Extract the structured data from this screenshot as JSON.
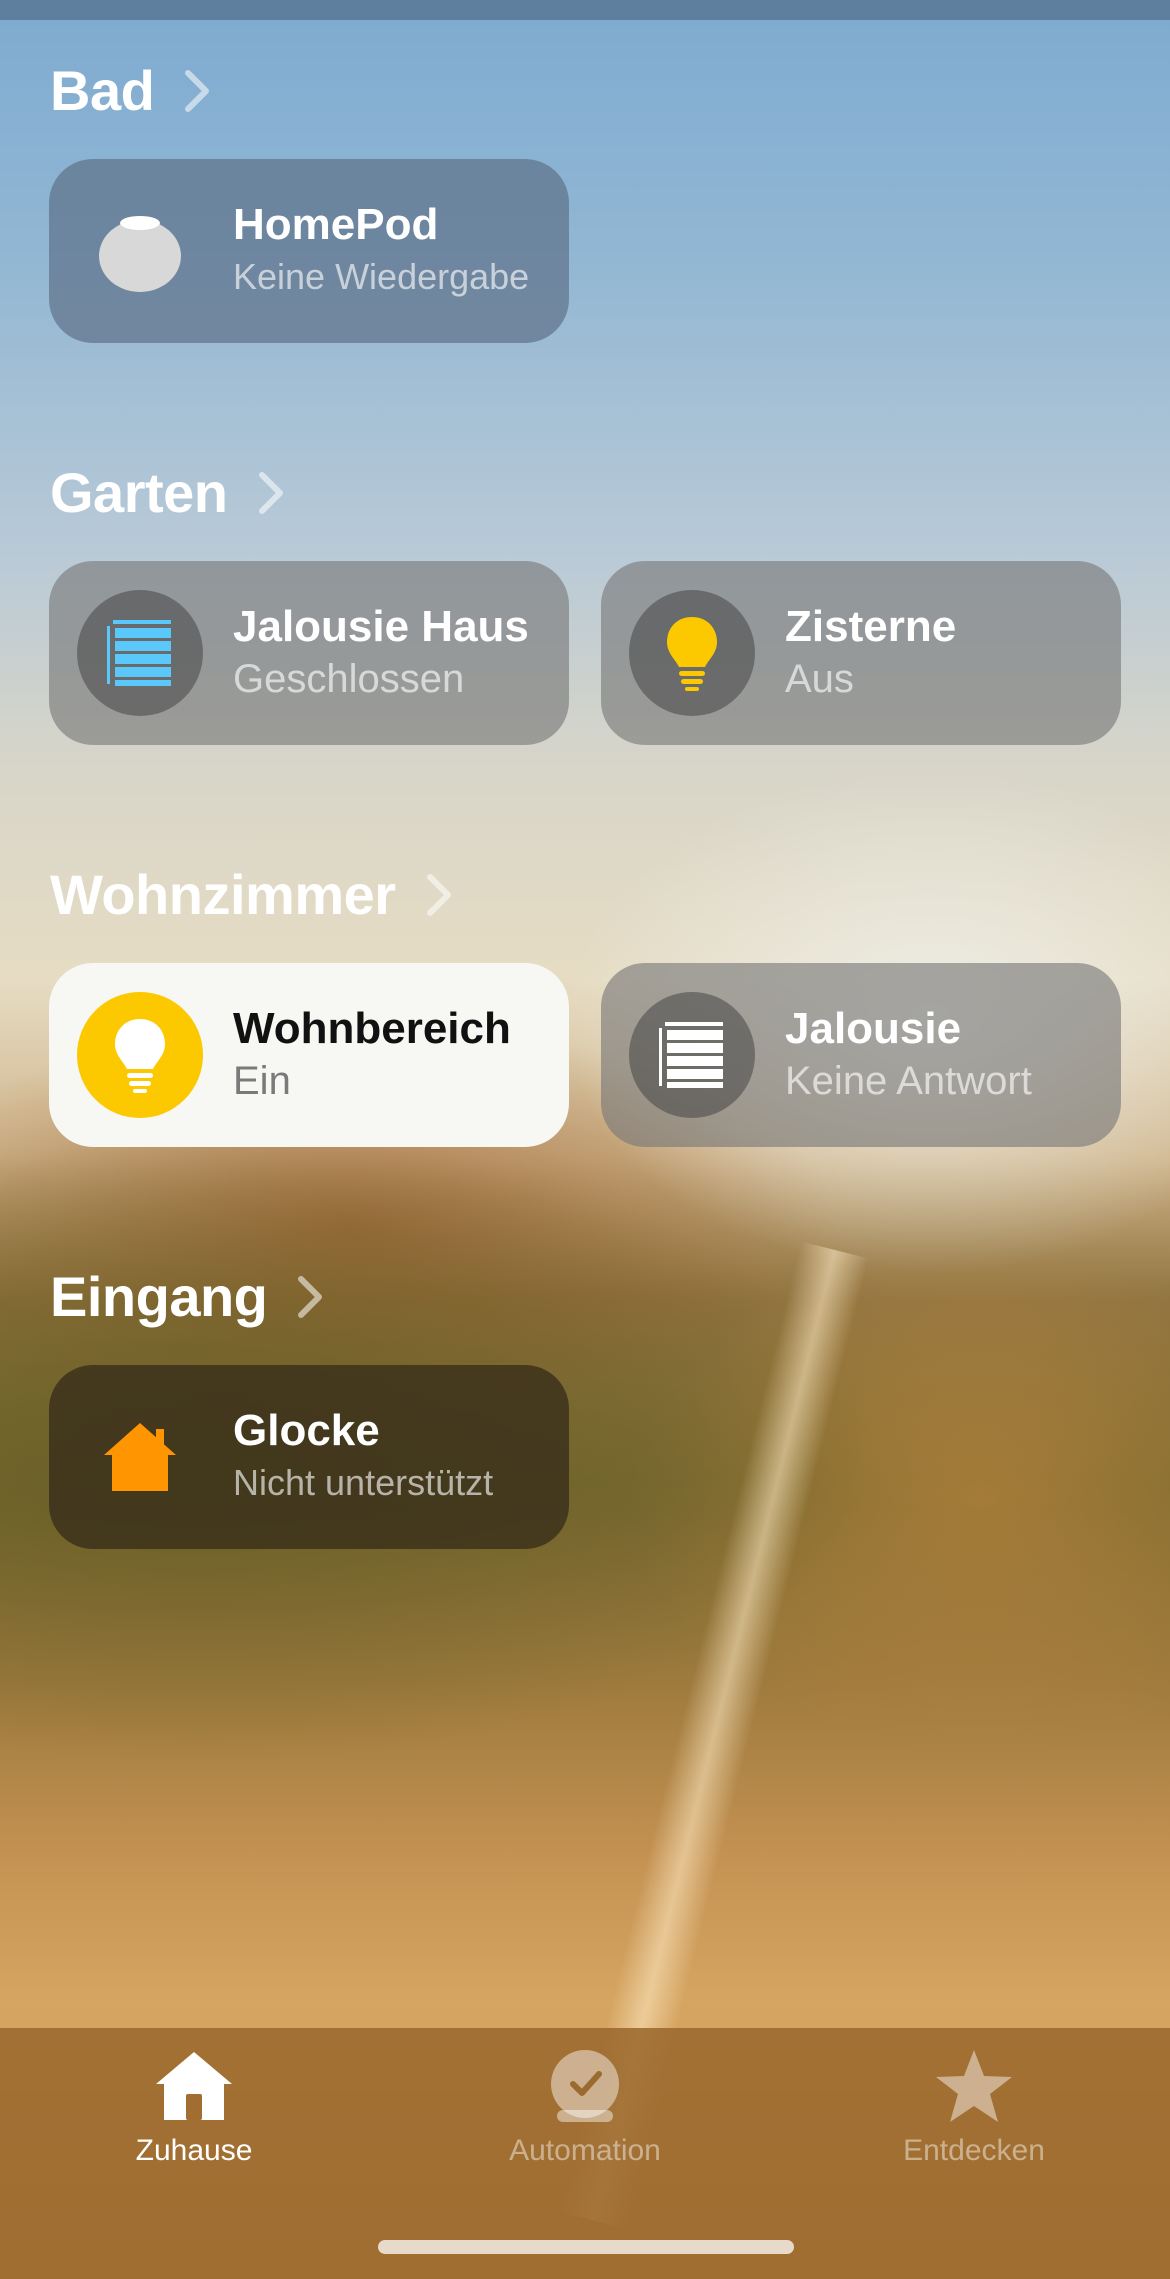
{
  "sections": [
    {
      "title": "Bad",
      "tiles": [
        {
          "name": "HomePod",
          "status": "Keine Wiedergabe",
          "icon": "homepod-icon",
          "state": "idle"
        }
      ]
    },
    {
      "title": "Garten",
      "tiles": [
        {
          "name": "Jalousie Haus",
          "status": "Geschlossen",
          "icon": "blinds-icon",
          "state": "closed",
          "icon_color": "#5ac8fa"
        },
        {
          "name": "Zisterne",
          "status": "Aus",
          "icon": "lightbulb-icon",
          "state": "off",
          "icon_color": "#fcc800"
        }
      ]
    },
    {
      "title": "Wohnzimmer",
      "tiles": [
        {
          "name": "Wohnbereich",
          "status": "Ein",
          "icon": "lightbulb-icon",
          "state": "on",
          "icon_color": "#ffffff",
          "bg_color": "#fcc800"
        },
        {
          "name": "Jalousie",
          "status": "Keine Antwort",
          "icon": "blinds-icon",
          "state": "no-response",
          "icon_color": "#ffffff"
        }
      ]
    },
    {
      "title": "Eingang",
      "tiles": [
        {
          "name": "Glocke",
          "status": "Nicht unterstützt",
          "icon": "house-icon",
          "state": "unsupported",
          "icon_color": "#ff9500"
        }
      ]
    }
  ],
  "tabbar": {
    "tabs": [
      {
        "label": "Zuhause",
        "icon": "house-icon",
        "active": true
      },
      {
        "label": "Automation",
        "icon": "clock-check-icon",
        "active": false
      },
      {
        "label": "Entdecken",
        "icon": "star-icon",
        "active": false
      }
    ]
  }
}
